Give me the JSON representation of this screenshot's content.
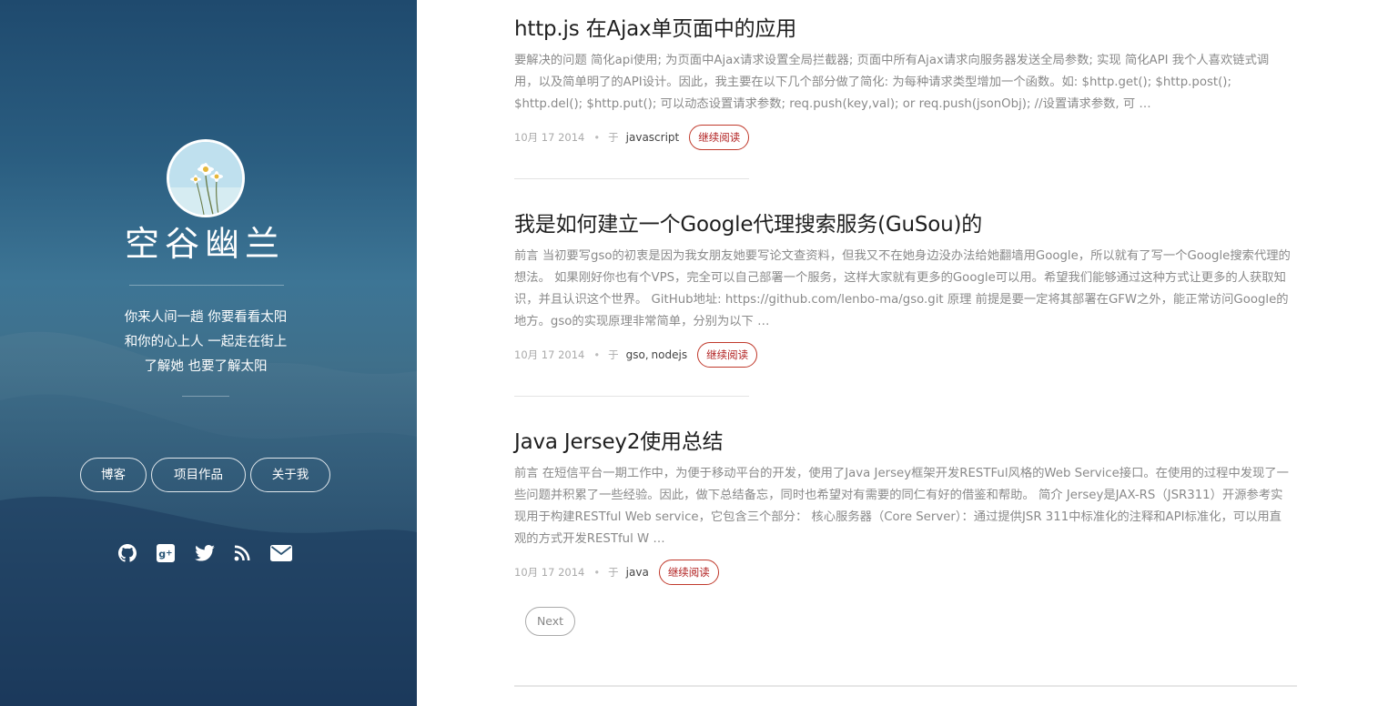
{
  "sidebar": {
    "site_title": "空谷幽兰",
    "motto": [
      "你来人间一趟 你要看看太阳",
      "和你的心上人 一起走在街上",
      "了解她 也要了解太阳"
    ],
    "nav": [
      {
        "label": "博客"
      },
      {
        "label": "项目作品"
      },
      {
        "label": "关于我"
      }
    ],
    "socials": [
      {
        "icon": "github-icon"
      },
      {
        "icon": "google-plus-icon"
      },
      {
        "icon": "twitter-icon"
      },
      {
        "icon": "rss-icon"
      },
      {
        "icon": "email-icon"
      }
    ]
  },
  "posts": [
    {
      "title": "http.js 在Ajax单页面中的应用",
      "excerpt": "要解决的问题 简化api使用; 为页面中Ajax请求设置全局拦截器; 页面中所有Ajax请求向服务器发送全局参数; 实现 简化API 我个人喜欢链式调用，以及简单明了的API设计。因此，我主要在以下几个部分做了简化: 为每种请求类型增加一个函数。如: $http.get(); $http.post(); $http.del(); $http.put(); 可以动态设置请求参数; req.push(key,val); or req.push(jsonObj); //设置请求参数, 可 …",
      "date": "10月 17 2014",
      "in": "于",
      "tags": [
        "javascript"
      ],
      "read_more": "继续阅读"
    },
    {
      "title": "我是如何建立一个Google代理搜索服务(GuSou)的",
      "excerpt": "前言 当初要写gso的初衷是因为我女朋友她要写论文查资料，但我又不在她身边没办法给她翻墙用Google，所以就有了写一个Google搜索代理的想法。 如果刚好你也有个VPS，完全可以自己部署一个服务，这样大家就有更多的Google可以用。希望我们能够通过这种方式让更多的人获取知识，并且认识这个世界。 GitHub地址: https://github.com/lenbo-ma/gso.git 原理 前提是要一定将其部署在GFW之外，能正常访问Google的地方。gso的实现原理非常简单，分别为以下 …",
      "date": "10月 17 2014",
      "in": "于",
      "tags": [
        "gso",
        "nodejs"
      ],
      "read_more": "继续阅读"
    },
    {
      "title": "Java Jersey2使用总结",
      "excerpt": "前言 在短信平台一期工作中，为便于移动平台的开发，使用了Java Jersey框架开发RESTFul风格的Web Service接口。在使用的过程中发现了一些问题并积累了一些经验。因此，做下总结备忘，同时也希望对有需要的同仁有好的借鉴和帮助。 简介 Jersey是JAX-RS（JSR311）开源参考实现用于构建RESTful Web service，它包含三个部分： 核心服务器（Core Server）：通过提供JSR 311中标准化的注释和API标准化，可以用直观的方式开发RESTful W …",
      "date": "10月 17 2014",
      "in": "于",
      "tags": [
        "java"
      ],
      "read_more": "继续阅读"
    }
  ],
  "pagination": {
    "next_label": "Next"
  }
}
